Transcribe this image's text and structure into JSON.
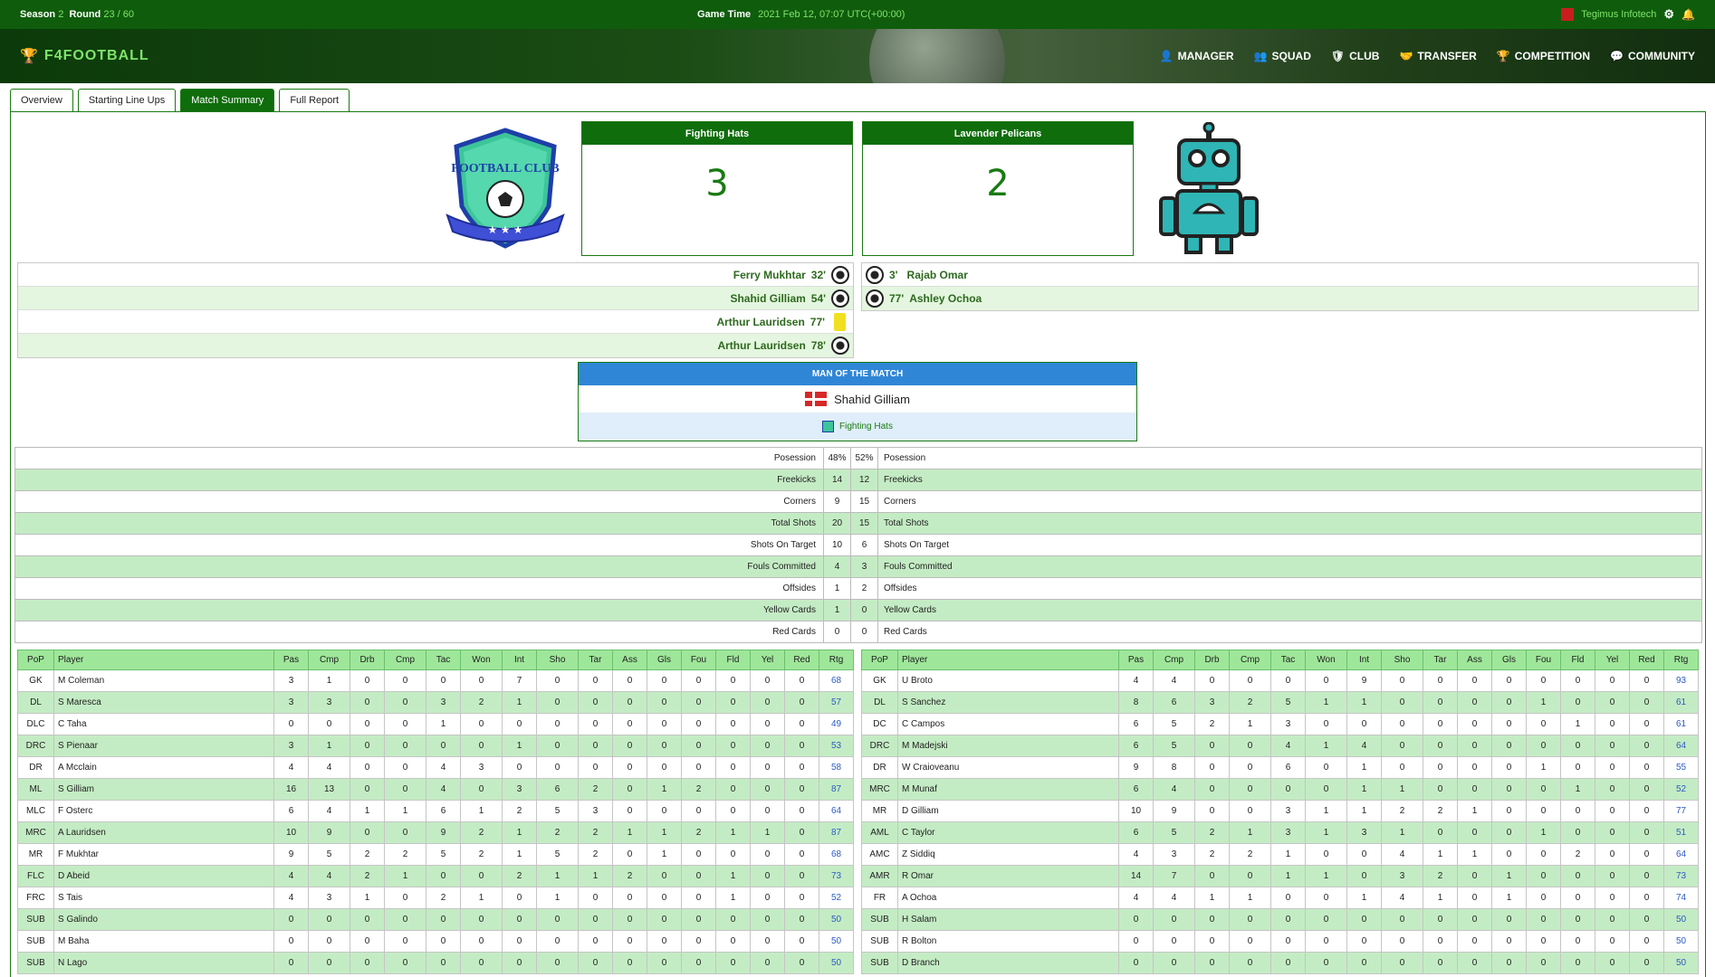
{
  "topbar": {
    "season_label": "Season",
    "season": "2",
    "round_label": "Round",
    "round": "23 / 60",
    "game_time_label": "Game Time",
    "game_time": "2021 Feb 12, 07:07 UTC(+00:00)",
    "user": "Tegimus Infotech"
  },
  "nav": {
    "logo": "F4FOOTBALL",
    "items": [
      "MANAGER",
      "SQUAD",
      "CLUB",
      "TRANSFER",
      "COMPETITION",
      "COMMUNITY"
    ]
  },
  "tabs": [
    "Overview",
    "Starting Line Ups",
    "Match Summary",
    "Full Report"
  ],
  "crest_text": "FOOTBALL CLUB",
  "home": {
    "name": "Fighting Hats",
    "score": "3"
  },
  "away": {
    "name": "Lavender Pelicans",
    "score": "2"
  },
  "home_events": [
    {
      "player": "Ferry Mukhtar",
      "min": "32'",
      "type": "goal"
    },
    {
      "player": "Shahid Gilliam",
      "min": "54'",
      "type": "goal"
    },
    {
      "player": "Arthur Lauridsen",
      "min": "77'",
      "type": "yellow"
    },
    {
      "player": "Arthur Lauridsen",
      "min": "78'",
      "type": "goal"
    }
  ],
  "away_events": [
    {
      "player": "Rajab Omar",
      "min": "3'",
      "type": "goal"
    },
    {
      "player": "Ashley Ochoa",
      "min": "77'",
      "type": "goal"
    }
  ],
  "motm": {
    "title": "MAN OF THE MATCH",
    "player": "Shahid Gilliam",
    "team": "Fighting Hats"
  },
  "stats": [
    [
      "Posession",
      "48%",
      "52%"
    ],
    [
      "Freekicks",
      "14",
      "12"
    ],
    [
      "Corners",
      "9",
      "15"
    ],
    [
      "Total Shots",
      "20",
      "15"
    ],
    [
      "Shots On Target",
      "10",
      "6"
    ],
    [
      "Fouls Committed",
      "4",
      "3"
    ],
    [
      "Offsides",
      "1",
      "2"
    ],
    [
      "Yellow Cards",
      "1",
      "0"
    ],
    [
      "Red Cards",
      "0",
      "0"
    ]
  ],
  "player_columns": [
    "PoP",
    "Player",
    "Pas",
    "Cmp",
    "Drb",
    "Cmp",
    "Tac",
    "Won",
    "Int",
    "Sho",
    "Tar",
    "Ass",
    "Gls",
    "Fou",
    "Fld",
    "Yel",
    "Red",
    "Rtg"
  ],
  "home_players": [
    [
      "GK",
      "M Coleman",
      "3",
      "1",
      "0",
      "0",
      "0",
      "0",
      "7",
      "0",
      "0",
      "0",
      "0",
      "0",
      "0",
      "0",
      "0",
      "68"
    ],
    [
      "DL",
      "S Maresca",
      "3",
      "3",
      "0",
      "0",
      "3",
      "2",
      "1",
      "0",
      "0",
      "0",
      "0",
      "0",
      "0",
      "0",
      "0",
      "57"
    ],
    [
      "DLC",
      "C Taha",
      "0",
      "0",
      "0",
      "0",
      "1",
      "0",
      "0",
      "0",
      "0",
      "0",
      "0",
      "0",
      "0",
      "0",
      "0",
      "49"
    ],
    [
      "DRC",
      "S Pienaar",
      "3",
      "1",
      "0",
      "0",
      "0",
      "0",
      "1",
      "0",
      "0",
      "0",
      "0",
      "0",
      "0",
      "0",
      "0",
      "53"
    ],
    [
      "DR",
      "A Mcclain",
      "4",
      "4",
      "0",
      "0",
      "4",
      "3",
      "0",
      "0",
      "0",
      "0",
      "0",
      "0",
      "0",
      "0",
      "0",
      "58"
    ],
    [
      "ML",
      "S Gilliam",
      "16",
      "13",
      "0",
      "0",
      "4",
      "0",
      "3",
      "6",
      "2",
      "0",
      "1",
      "2",
      "0",
      "0",
      "0",
      "87"
    ],
    [
      "MLC",
      "F Osterc",
      "6",
      "4",
      "1",
      "1",
      "6",
      "1",
      "2",
      "5",
      "3",
      "0",
      "0",
      "0",
      "0",
      "0",
      "0",
      "64"
    ],
    [
      "MRC",
      "A Lauridsen",
      "10",
      "9",
      "0",
      "0",
      "9",
      "2",
      "1",
      "2",
      "2",
      "1",
      "1",
      "2",
      "1",
      "1",
      "0",
      "87"
    ],
    [
      "MR",
      "F Mukhtar",
      "9",
      "5",
      "2",
      "2",
      "5",
      "2",
      "1",
      "5",
      "2",
      "0",
      "1",
      "0",
      "0",
      "0",
      "0",
      "68"
    ],
    [
      "FLC",
      "D Abeid",
      "4",
      "4",
      "2",
      "1",
      "0",
      "0",
      "2",
      "1",
      "1",
      "2",
      "0",
      "0",
      "1",
      "0",
      "0",
      "73"
    ],
    [
      "FRC",
      "S Tais",
      "4",
      "3",
      "1",
      "0",
      "2",
      "1",
      "0",
      "1",
      "0",
      "0",
      "0",
      "0",
      "1",
      "0",
      "0",
      "52"
    ],
    [
      "SUB",
      "S Galindo",
      "0",
      "0",
      "0",
      "0",
      "0",
      "0",
      "0",
      "0",
      "0",
      "0",
      "0",
      "0",
      "0",
      "0",
      "0",
      "50"
    ],
    [
      "SUB",
      "M Baha",
      "0",
      "0",
      "0",
      "0",
      "0",
      "0",
      "0",
      "0",
      "0",
      "0",
      "0",
      "0",
      "0",
      "0",
      "0",
      "50"
    ],
    [
      "SUB",
      "N Lago",
      "0",
      "0",
      "0",
      "0",
      "0",
      "0",
      "0",
      "0",
      "0",
      "0",
      "0",
      "0",
      "0",
      "0",
      "0",
      "50"
    ]
  ],
  "away_players": [
    [
      "GK",
      "U Broto",
      "4",
      "4",
      "0",
      "0",
      "0",
      "0",
      "9",
      "0",
      "0",
      "0",
      "0",
      "0",
      "0",
      "0",
      "0",
      "93"
    ],
    [
      "DL",
      "S Sanchez",
      "8",
      "6",
      "3",
      "2",
      "5",
      "1",
      "1",
      "0",
      "0",
      "0",
      "0",
      "1",
      "0",
      "0",
      "0",
      "61"
    ],
    [
      "DC",
      "C Campos",
      "6",
      "5",
      "2",
      "1",
      "3",
      "0",
      "0",
      "0",
      "0",
      "0",
      "0",
      "0",
      "1",
      "0",
      "0",
      "61"
    ],
    [
      "DRC",
      "M Madejski",
      "6",
      "5",
      "0",
      "0",
      "4",
      "1",
      "4",
      "0",
      "0",
      "0",
      "0",
      "0",
      "0",
      "0",
      "0",
      "64"
    ],
    [
      "DR",
      "W Craioveanu",
      "9",
      "8",
      "0",
      "0",
      "6",
      "0",
      "1",
      "0",
      "0",
      "0",
      "0",
      "1",
      "0",
      "0",
      "0",
      "55"
    ],
    [
      "MRC",
      "M Munaf",
      "6",
      "4",
      "0",
      "0",
      "0",
      "0",
      "1",
      "1",
      "0",
      "0",
      "0",
      "0",
      "1",
      "0",
      "0",
      "52"
    ],
    [
      "MR",
      "D Gilliam",
      "10",
      "9",
      "0",
      "0",
      "3",
      "1",
      "1",
      "2",
      "2",
      "1",
      "0",
      "0",
      "0",
      "0",
      "0",
      "77"
    ],
    [
      "AML",
      "C Taylor",
      "6",
      "5",
      "2",
      "1",
      "3",
      "1",
      "3",
      "1",
      "0",
      "0",
      "0",
      "1",
      "0",
      "0",
      "0",
      "51"
    ],
    [
      "AMC",
      "Z Siddiq",
      "4",
      "3",
      "2",
      "2",
      "1",
      "0",
      "0",
      "4",
      "1",
      "1",
      "0",
      "0",
      "2",
      "0",
      "0",
      "64"
    ],
    [
      "AMR",
      "R Omar",
      "14",
      "7",
      "0",
      "0",
      "1",
      "1",
      "0",
      "3",
      "2",
      "0",
      "1",
      "0",
      "0",
      "0",
      "0",
      "73"
    ],
    [
      "FR",
      "A Ochoa",
      "4",
      "4",
      "1",
      "1",
      "0",
      "0",
      "1",
      "4",
      "1",
      "0",
      "1",
      "0",
      "0",
      "0",
      "0",
      "74"
    ],
    [
      "SUB",
      "H Salam",
      "0",
      "0",
      "0",
      "0",
      "0",
      "0",
      "0",
      "0",
      "0",
      "0",
      "0",
      "0",
      "0",
      "0",
      "0",
      "50"
    ],
    [
      "SUB",
      "R Bolton",
      "0",
      "0",
      "0",
      "0",
      "0",
      "0",
      "0",
      "0",
      "0",
      "0",
      "0",
      "0",
      "0",
      "0",
      "0",
      "50"
    ],
    [
      "SUB",
      "D Branch",
      "0",
      "0",
      "0",
      "0",
      "0",
      "0",
      "0",
      "0",
      "0",
      "0",
      "0",
      "0",
      "0",
      "0",
      "0",
      "50"
    ]
  ]
}
